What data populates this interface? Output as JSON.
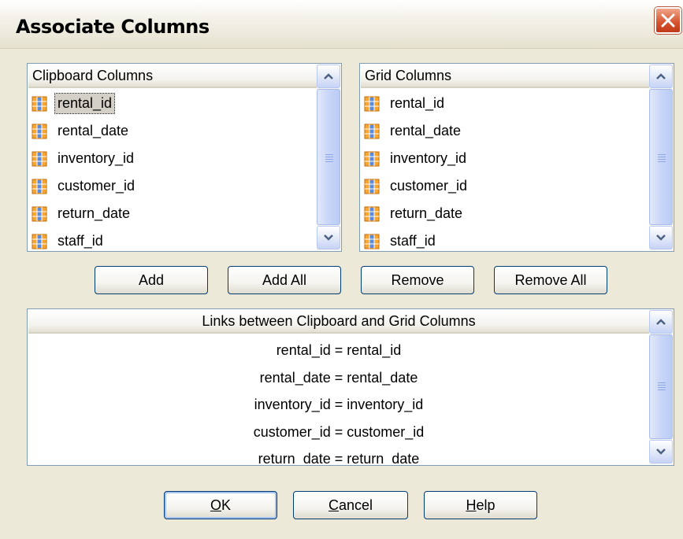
{
  "window": {
    "title": "Associate Columns"
  },
  "clipboard": {
    "header": "Clipboard Columns",
    "items": [
      "rental_id",
      "rental_date",
      "inventory_id",
      "customer_id",
      "return_date",
      "staff_id"
    ],
    "selected": "rental_id"
  },
  "grid": {
    "header": "Grid Columns",
    "items": [
      "rental_id",
      "rental_date",
      "inventory_id",
      "customer_id",
      "return_date",
      "staff_id"
    ]
  },
  "actions": {
    "add": "Add",
    "add_all": "Add All",
    "remove": "Remove",
    "remove_all": "Remove All"
  },
  "links": {
    "header": "Links between Clipboard and Grid Columns",
    "items": [
      "rental_id = rental_id",
      "rental_date = rental_date",
      "inventory_id = inventory_id",
      "customer_id = customer_id",
      "return_date = return_date"
    ]
  },
  "footer": {
    "ok": "OK",
    "ok_mnemonic": "O",
    "cancel": "Cancel",
    "cancel_mnemonic": "C",
    "help": "Help",
    "help_mnemonic": "H"
  },
  "icons": {
    "column": "table-column-icon",
    "close": "close-icon",
    "scroll_up": "chevron-up-icon",
    "scroll_down": "chevron-down-icon"
  },
  "colors": {
    "list_border": "#7F9DB9",
    "close_red": "#D5522E",
    "selected_bg": "#D4D0C8"
  }
}
